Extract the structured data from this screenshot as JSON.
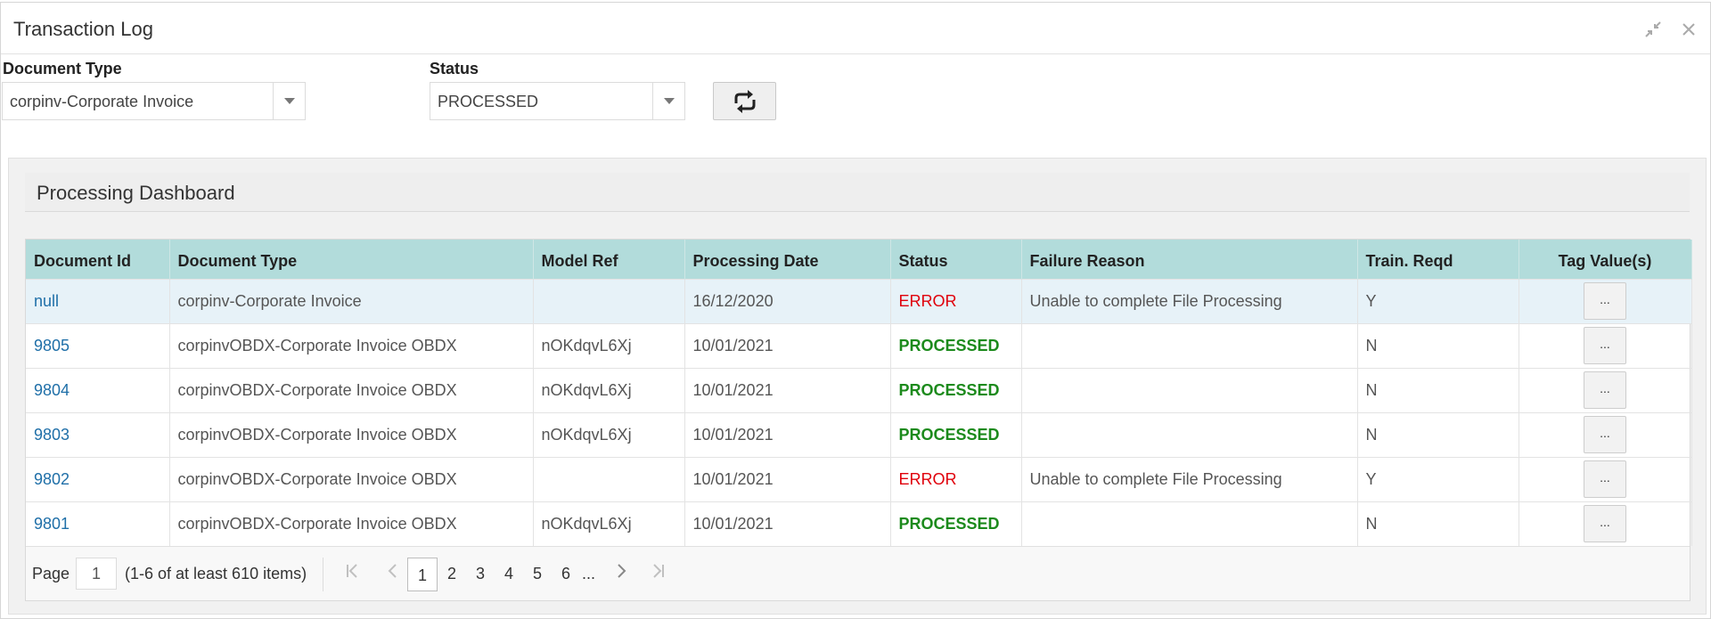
{
  "window": {
    "title": "Transaction Log"
  },
  "filters": {
    "doc_type_label": "Document Type",
    "doc_type_value": "corpinv-Corporate Invoice",
    "status_label": "Status",
    "status_value": "PROCESSED"
  },
  "dashboard": {
    "title": "Processing Dashboard",
    "columns": [
      "Document Id",
      "Document Type",
      "Model Ref",
      "Processing Date",
      "Status",
      "Failure Reason",
      "Train. Reqd",
      "Tag Value(s)"
    ],
    "rows": [
      {
        "id": "null",
        "type": "corpinv-Corporate Invoice",
        "model": "",
        "date": "16/12/2020",
        "status": "ERROR",
        "reason": "Unable to complete File Processing",
        "train": "Y",
        "tag": "..."
      },
      {
        "id": "9805",
        "type": "corpinvOBDX-Corporate Invoice OBDX",
        "model": "nOKdqvL6Xj",
        "date": "10/01/2021",
        "status": "PROCESSED",
        "reason": "",
        "train": "N",
        "tag": "..."
      },
      {
        "id": "9804",
        "type": "corpinvOBDX-Corporate Invoice OBDX",
        "model": "nOKdqvL6Xj",
        "date": "10/01/2021",
        "status": "PROCESSED",
        "reason": "",
        "train": "N",
        "tag": "..."
      },
      {
        "id": "9803",
        "type": "corpinvOBDX-Corporate Invoice OBDX",
        "model": "nOKdqvL6Xj",
        "date": "10/01/2021",
        "status": "PROCESSED",
        "reason": "",
        "train": "N",
        "tag": "..."
      },
      {
        "id": "9802",
        "type": "corpinvOBDX-Corporate Invoice OBDX",
        "model": "",
        "date": "10/01/2021",
        "status": "ERROR",
        "reason": "Unable to complete File Processing",
        "train": "Y",
        "tag": "..."
      },
      {
        "id": "9801",
        "type": "corpinvOBDX-Corporate Invoice OBDX",
        "model": "nOKdqvL6Xj",
        "date": "10/01/2021",
        "status": "PROCESSED",
        "reason": "",
        "train": "N",
        "tag": "..."
      }
    ]
  },
  "pager": {
    "page_label": "Page",
    "page_value": "1",
    "info": "(1-6 of at least 610 items)",
    "pages": [
      "1",
      "2",
      "3",
      "4",
      "5",
      "6"
    ],
    "ellipsis": "..."
  },
  "colors": {
    "header_bg": "#b2dcdb",
    "error": "#e0000b",
    "processed": "#1c8a1c",
    "link": "#1f6fa8"
  },
  "icons": [
    "minimize-icon",
    "close-icon",
    "chevron-down-icon",
    "refresh-icon",
    "first-page-icon",
    "prev-page-icon",
    "next-page-icon",
    "last-page-icon"
  ]
}
